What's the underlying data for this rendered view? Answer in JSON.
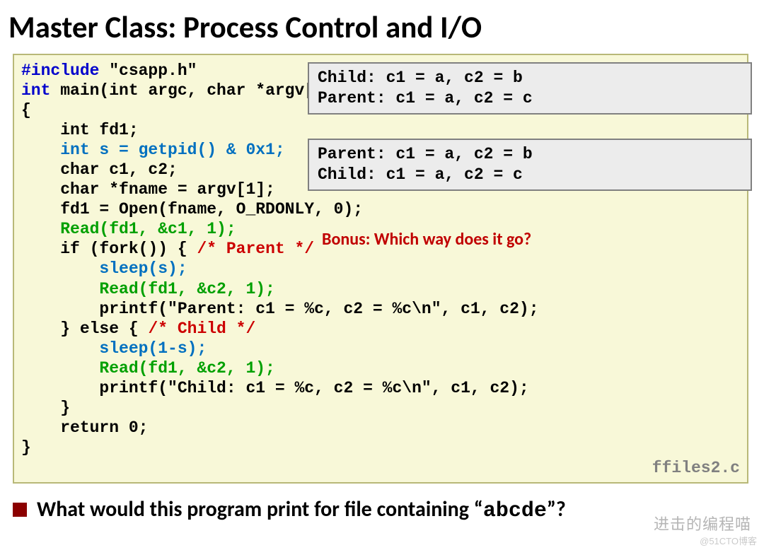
{
  "title": "Master Class: Process Control and I/O",
  "code": {
    "l1a": "#include",
    "l1b": " \"csapp.h\"",
    "l2a": "int",
    "l2b": " main(int argc, char *argv[])",
    "l3": "{",
    "l4": "    int fd1;",
    "l5": "    int s = getpid() & 0x1;",
    "l6": "    char c1, c2;",
    "l7": "    char *fname = argv[1];",
    "l8": "    fd1 = Open(fname, O_RDONLY, 0);",
    "l9": "    Read(fd1, &c1, 1);",
    "l10a": "    if (fork()) { ",
    "l10b": "/* Parent */",
    "l11": "        sleep(s);",
    "l12": "        Read(fd1, &c2, 1);",
    "l13": "        printf(\"Parent: c1 = %c, c2 = %c\\n\", c1, c2);",
    "l14a": "    } else { ",
    "l14b": "/* Child */",
    "l15": "        sleep(1-s);",
    "l16": "        Read(fd1, &c2, 1);",
    "l17": "        printf(\"Child: c1 = %c, c2 = %c\\n\", c1, c2);",
    "l18": "    }",
    "l19": "    return 0;",
    "l20": "}",
    "filename": "ffiles2.c"
  },
  "output1": {
    "line1": "Child: c1 = a, c2 = b",
    "line2": "Parent: c1 = a, c2 = c"
  },
  "output2": {
    "line1": "Parent: c1 = a, c2 = b",
    "line2": "Child: c1 = a, c2 = c"
  },
  "bonus": "Bonus: Which way does it go?",
  "question": {
    "pre": "What would this program print for file containing “",
    "mono": "abcde",
    "post": "”?"
  },
  "watermark1": "进击的编程喵",
  "watermark2": "@51CTO博客"
}
